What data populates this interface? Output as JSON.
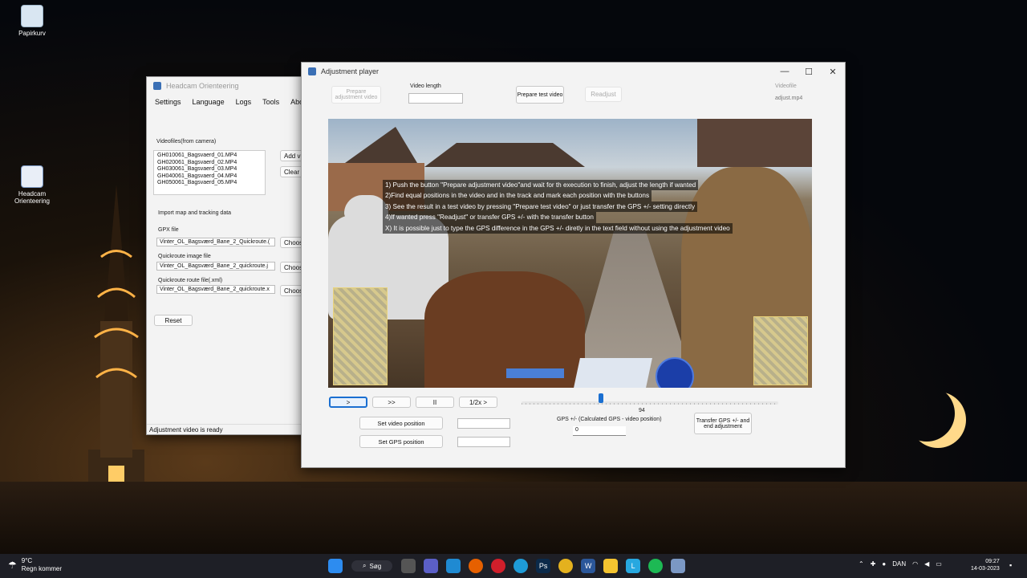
{
  "desktop": {
    "recycle_bin_label": "Papirkurv",
    "app_shortcut_label": "Headcam Orienteering"
  },
  "main_window": {
    "title": "Headcam Orienteering",
    "menu": [
      "Settings",
      "Language",
      "Logs",
      "Tools",
      "About"
    ],
    "videofiles_label": "Videofiles(from camera)",
    "videofiles": [
      "GH010061_Bagsvaerd_01.MP4",
      "GH020061_Bagsvaerd_02.MP4",
      "GH030061_Bagsvaerd_03.MP4",
      "GH040061_Bagsvaerd_04.MP4",
      "GH050061_Bagsvaerd_05.MP4"
    ],
    "add_button": "Add vi",
    "clear_button": "Clear l",
    "import_section_label": "Import map and tracking data",
    "gpx_label": "GPX file",
    "gpx_value": "Vinter_OL_Bagsværd_Bane_2_Quickroute.(",
    "quickroute_image_label": "Quickroute image file",
    "quickroute_image_value": "Vinter_OL_Bagsværd_Bane_2_quickroute.j",
    "quickroute_route_label": "Quickroute route file(.xml)",
    "quickroute_route_value": "Vinter_OL_Bagsværd_Bane_2_quickroute.x",
    "choose_label": "Choos",
    "reset_button": "Reset",
    "status": "Adjustment video is ready"
  },
  "adjust_window": {
    "title": "Adjustment player",
    "prepare_adjustment_button": "Prepare adjustment video",
    "video_length_label": "Video length",
    "video_length_value": "",
    "prepare_test_button": "Prepare test video",
    "readjust_button": "Readjust",
    "videofile_label": "Videofile",
    "videofile_value": "adjust.mp4",
    "instructions": [
      "1) Push the button \"Prepare adjustment video\"and wait for th execution to finish, adjust the length if wanted",
      "2)Find equal positions in the video and in the track and mark each position with the buttons",
      "3) See the result in a test video by  pressing \"Prepare test video\" or  just transfer the GPS +/- setting directly",
      "4)If wanted press \"Readjust\" or transfer GPS +/- with the transfer button",
      "X) It is possible just to type the GPS difference in the GPS +/- diretly in the text field without using the adjustment video"
    ],
    "play_button": ">",
    "fast_forward_button": ">>",
    "pause_button": "II",
    "half_speed_button": "1/2x >",
    "slider_value": "94",
    "slider_fraction": 0.31,
    "set_video_position_button": "Set video position",
    "set_gps_position_button": "Set GPS position",
    "gps_label": "GPS +/- (Calculated GPS - video position)",
    "gps_value": "0",
    "transfer_button": "Transfer GPS +/- and end adjustment"
  },
  "taskbar": {
    "weather_temp": "9°C",
    "weather_desc": "Regn kommer",
    "search_label": "Søg",
    "language": "DAN",
    "time": "09:27",
    "date": "14-03-2023"
  },
  "colors": {
    "accent": "#1a6fd1",
    "taskbar": "#1e1f26"
  }
}
